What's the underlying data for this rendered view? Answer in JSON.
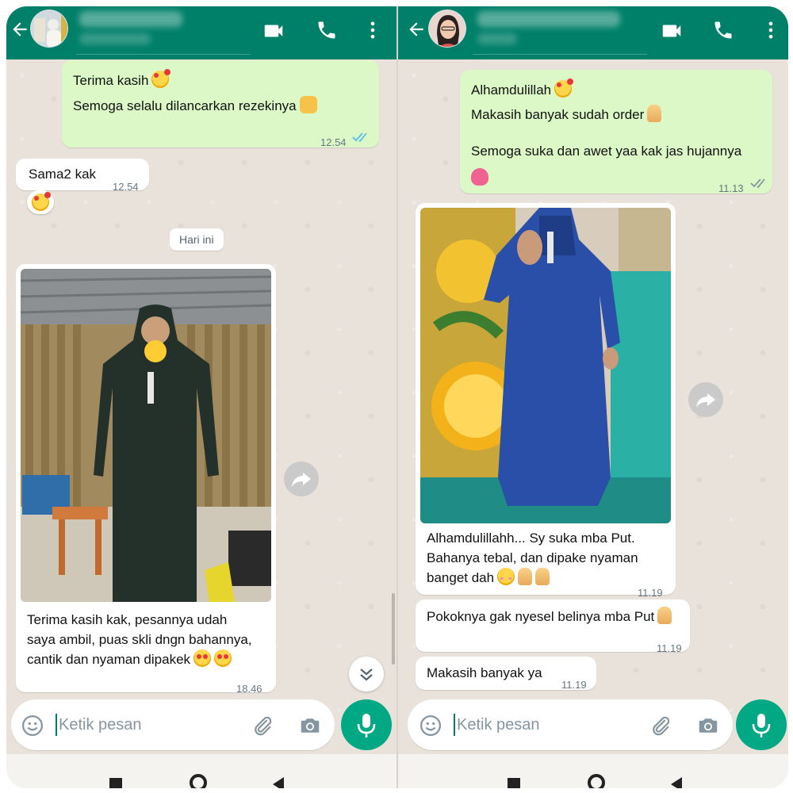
{
  "left": {
    "header": {
      "contact_name": "",
      "contact_status": ""
    },
    "messages": {
      "out1": {
        "line1": "Terima kasih",
        "line2": "Semoga selalu dilancarkan rezekinya",
        "time": "12.54"
      },
      "in1": {
        "text": "Sama2 kak",
        "time": "12.54"
      },
      "date_divider": "Hari ini",
      "photo_caption": {
        "line1": "Terima kasih kak, pesannya udah",
        "line2": "saya ambil, puas skli dngn bahannya,",
        "line3": "cantik dan nyaman dipakek",
        "time": "18.46"
      }
    },
    "input": {
      "placeholder": "Ketik pesan"
    }
  },
  "right": {
    "header": {
      "contact_name": "",
      "contact_status": ""
    },
    "messages": {
      "out1": {
        "line1": "Alhamdulillah",
        "line2": "Makasih banyak sudah order",
        "line3": "Semoga suka dan awet yaa kak jas hujannya",
        "time": "11.13"
      },
      "photo_caption": {
        "line1": "Alhamdulillahh... Sy suka mba Put.",
        "line2": "Bahanya tebal, dan dipake nyaman",
        "line3": "banget dah",
        "time": "11.19"
      },
      "in2": {
        "text": "Pokoknya gak nyesel belinya mba Put",
        "time": "11.19"
      },
      "in3": {
        "text": "Makasih banyak ya",
        "time": "11.19"
      }
    },
    "input": {
      "placeholder": "Ketik pesan"
    }
  },
  "colors": {
    "header": "#008069",
    "outgoing": "#dcf8c6",
    "incoming": "#ffffff",
    "mic": "#00a884",
    "read_ticks": "#53bdeb"
  },
  "icons": [
    "back-arrow-icon",
    "video-call-icon",
    "phone-icon",
    "more-vert-icon",
    "emoji-icon",
    "attach-icon",
    "camera-icon",
    "mic-icon",
    "forward-icon",
    "chevron-double-down-icon",
    "double-check-icon"
  ]
}
